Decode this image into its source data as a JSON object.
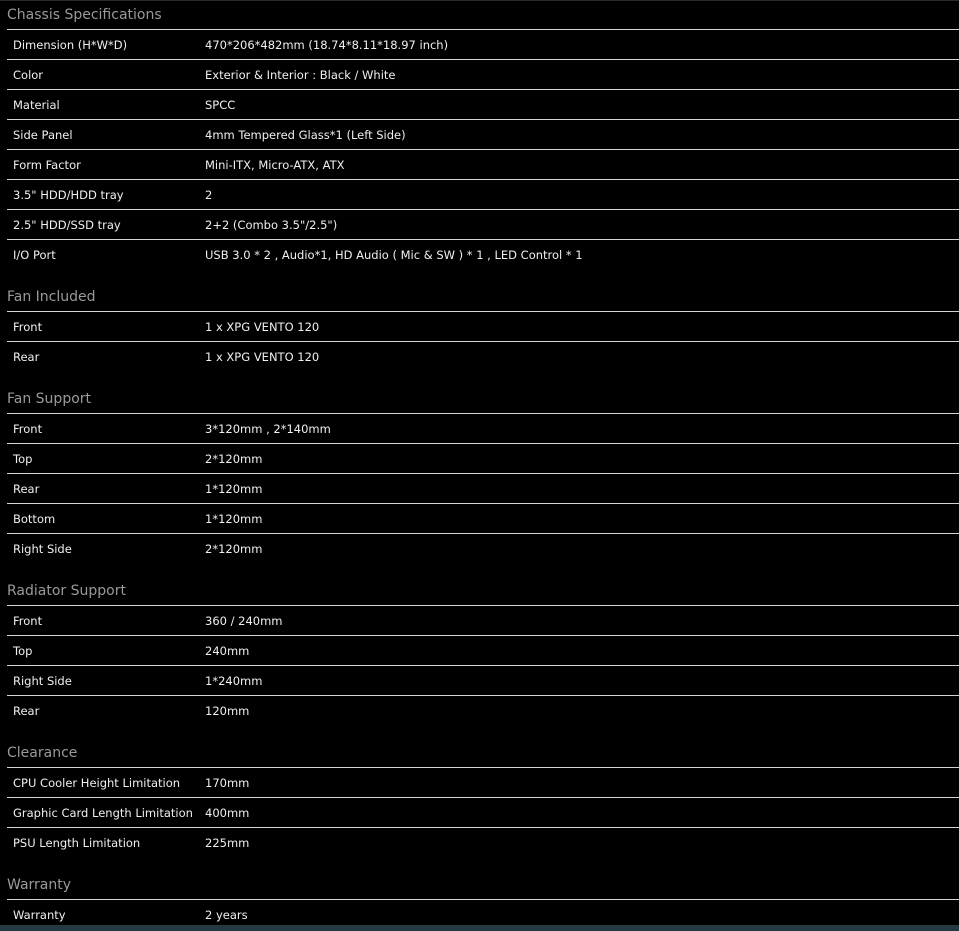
{
  "sections": [
    {
      "title": "Chassis Specifications",
      "rows": [
        {
          "label": "Dimension (H*W*D)",
          "value": "470*206*482mm (18.74*8.11*18.97 inch)"
        },
        {
          "label": "Color",
          "value": "Exterior & Interior : Black / White"
        },
        {
          "label": "Material",
          "value": "SPCC"
        },
        {
          "label": "Side Panel",
          "value": "4mm Tempered Glass*1 (Left Side)"
        },
        {
          "label": "Form Factor",
          "value": "Mini-ITX, Micro-ATX, ATX"
        },
        {
          "label": "3.5\" HDD/HDD tray",
          "value": "2"
        },
        {
          "label": "2.5\" HDD/SSD tray",
          "value": "2+2 (Combo 3.5\"/2.5\")"
        },
        {
          "label": "I/O Port",
          "value": "USB 3.0 * 2 , Audio*1, HD Audio ( Mic & SW ) * 1 , LED Control * 1"
        }
      ]
    },
    {
      "title": "Fan Included",
      "rows": [
        {
          "label": "Front",
          "value": "1 x XPG VENTO 120"
        },
        {
          "label": "Rear",
          "value": "1 x XPG VENTO 120"
        }
      ]
    },
    {
      "title": "Fan Support",
      "rows": [
        {
          "label": "Front",
          "value": "3*120mm , 2*140mm"
        },
        {
          "label": "Top",
          "value": "2*120mm"
        },
        {
          "label": "Rear",
          "value": "1*120mm"
        },
        {
          "label": "Bottom",
          "value": "1*120mm"
        },
        {
          "label": "Right Side",
          "value": "2*120mm"
        }
      ]
    },
    {
      "title": "Radiator Support",
      "rows": [
        {
          "label": "Front",
          "value": "360 / 240mm"
        },
        {
          "label": "Top",
          "value": "240mm"
        },
        {
          "label": "Right Side",
          "value": "1*240mm"
        },
        {
          "label": "Rear",
          "value": "120mm"
        }
      ]
    },
    {
      "title": "Clearance",
      "rows": [
        {
          "label": "CPU Cooler Height Limitation",
          "value": "170mm"
        },
        {
          "label": "Graphic Card Length Limitation",
          "value": "400mm"
        },
        {
          "label": "PSU Length Limitation",
          "value": "225mm"
        }
      ]
    },
    {
      "title": "Warranty",
      "rows": [
        {
          "label": "Warranty",
          "value": "2 years"
        }
      ]
    }
  ]
}
